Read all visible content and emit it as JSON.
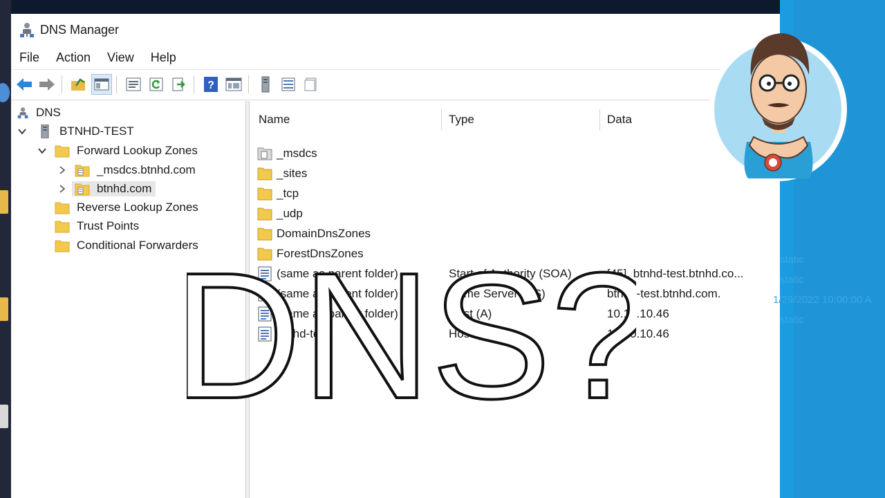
{
  "window": {
    "title": "DNS Manager",
    "menu": [
      "File",
      "Action",
      "View",
      "Help"
    ]
  },
  "toolbar": {
    "buttons": [
      "back-icon",
      "forward-icon",
      "up-folder-icon",
      "show-tree-icon",
      "properties-icon",
      "refresh-icon",
      "export-list-icon",
      "help-icon",
      "console-icon",
      "server-icon",
      "list-view-icon",
      "detail-view-icon"
    ]
  },
  "tree": {
    "root": "DNS",
    "server": "BTNHD-TEST",
    "forward_zones": "Forward Lookup Zones",
    "zone_msdcs": "_msdcs.btnhd.com",
    "zone_btnhd": "btnhd.com",
    "reverse_zones": "Reverse Lookup Zones",
    "trust_points": "Trust Points",
    "conditional_forwarders": "Conditional Forwarders"
  },
  "list": {
    "columns": [
      "Name",
      "Type",
      "Data"
    ],
    "rows": [
      {
        "name": "_msdcs",
        "type": "",
        "data": "",
        "icon": "zone-folder-icon"
      },
      {
        "name": "_sites",
        "type": "",
        "data": "",
        "icon": "folder-icon"
      },
      {
        "name": "_tcp",
        "type": "",
        "data": "",
        "icon": "folder-icon"
      },
      {
        "name": "_udp",
        "type": "",
        "data": "",
        "icon": "folder-icon"
      },
      {
        "name": "DomainDnsZones",
        "type": "",
        "data": "",
        "icon": "folder-icon"
      },
      {
        "name": "ForestDnsZones",
        "type": "",
        "data": "",
        "icon": "folder-icon"
      },
      {
        "name": "(same as parent folder)",
        "type": "Start of Authority (SOA)",
        "data": "[45], btnhd-test.btnhd.co...",
        "icon": "record-icon"
      },
      {
        "name": "(same as parent folder)",
        "type": "Name Server (NS)",
        "data": "btnhd-test.btnhd.com.",
        "icon": "record-icon"
      },
      {
        "name": "(same as parent folder)",
        "type": "Host (A)",
        "data": "10.10.10.46",
        "icon": "record-icon"
      },
      {
        "name": "btnhd-test",
        "type": "Host (A)",
        "data": "10.10.10.46",
        "icon": "record-icon"
      }
    ]
  },
  "background_text": {
    "static_1": "static",
    "static_2": "static",
    "timestamp": "1/29/2022 10:00:00 A",
    "static_3": "static"
  },
  "overlay_text": "DNS?",
  "colors": {
    "accent_blue": "#1b9be0",
    "window_bg": "#ffffff",
    "folder_yellow": "#f2c94c"
  }
}
